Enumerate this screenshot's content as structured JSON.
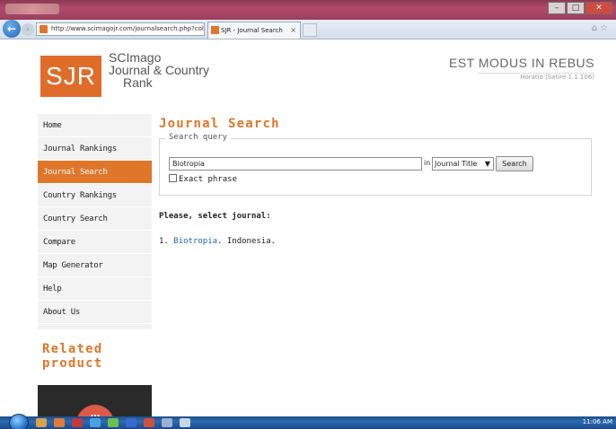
{
  "browser": {
    "address": "http://www.scimagojr.com/journalsearch.php?collec ρ ▾ C",
    "tab_title": "SJR - Journal Search",
    "tab_close": "×",
    "back": "←",
    "window_controls": [
      "–",
      "□",
      "✕"
    ]
  },
  "header": {
    "logo": "SJR",
    "logo_lines": [
      "SCImago",
      "Journal & Country",
      "Rank"
    ],
    "motto": "EST MODUS IN REBUS",
    "version": "Horatio (Satire 1.1.106)"
  },
  "sidebar": {
    "items": [
      {
        "label": "Home",
        "active": false
      },
      {
        "label": "Journal Rankings",
        "active": false
      },
      {
        "label": "Journal Search",
        "active": true
      },
      {
        "label": "Country Rankings",
        "active": false
      },
      {
        "label": "Country Search",
        "active": false
      },
      {
        "label": "Compare",
        "active": false
      },
      {
        "label": "Map Generator",
        "active": false
      },
      {
        "label": "Help",
        "active": false
      },
      {
        "label": "About Us",
        "active": false
      }
    ],
    "related_heading": "Related product",
    "product_icon": "building-icon"
  },
  "main": {
    "heading": "Journal Search",
    "legend": "Search query",
    "search_value": "Biotropia",
    "in_label": "in",
    "select_value": "Journal Title",
    "search_button": "Search",
    "exact_label": "Exact phrase",
    "select_prompt": "Please, select journal:",
    "results": [
      {
        "index": "1.",
        "title": "Biotropia",
        "country": ". Indonesia."
      }
    ]
  },
  "taskbar": {
    "clock": "11:06 AM"
  },
  "colors": {
    "accent": "#e0762a",
    "link": "#2a62b8"
  }
}
